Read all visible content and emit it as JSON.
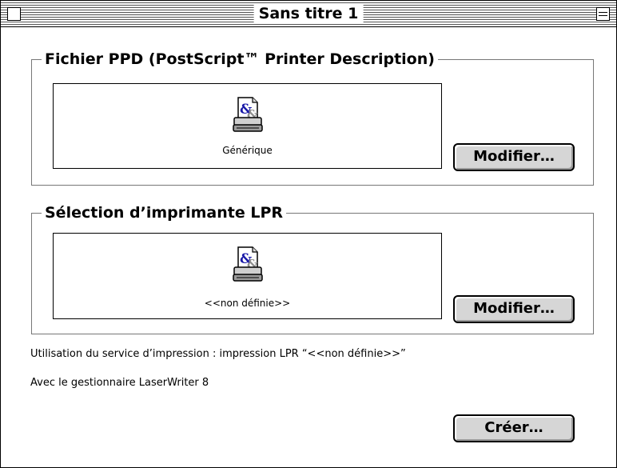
{
  "window": {
    "title": "Sans titre 1"
  },
  "ppd_section": {
    "title": "Fichier PPD (PostScript™ Printer Description)",
    "selection_label": "Générique",
    "modify_label": "Modifier…",
    "icon": "printer-document-icon"
  },
  "lpr_section": {
    "title": "Sélection d’imprimante LPR",
    "selection_label": "<<non définie>>",
    "modify_label": "Modifier…",
    "icon": "printer-document-icon"
  },
  "info": {
    "service_line": "Utilisation du service d’impression : impression LPR “<<non définie>>”",
    "driver_line": "Avec le gestionnaire LaserWriter 8"
  },
  "actions": {
    "create_label": "Créer…"
  }
}
